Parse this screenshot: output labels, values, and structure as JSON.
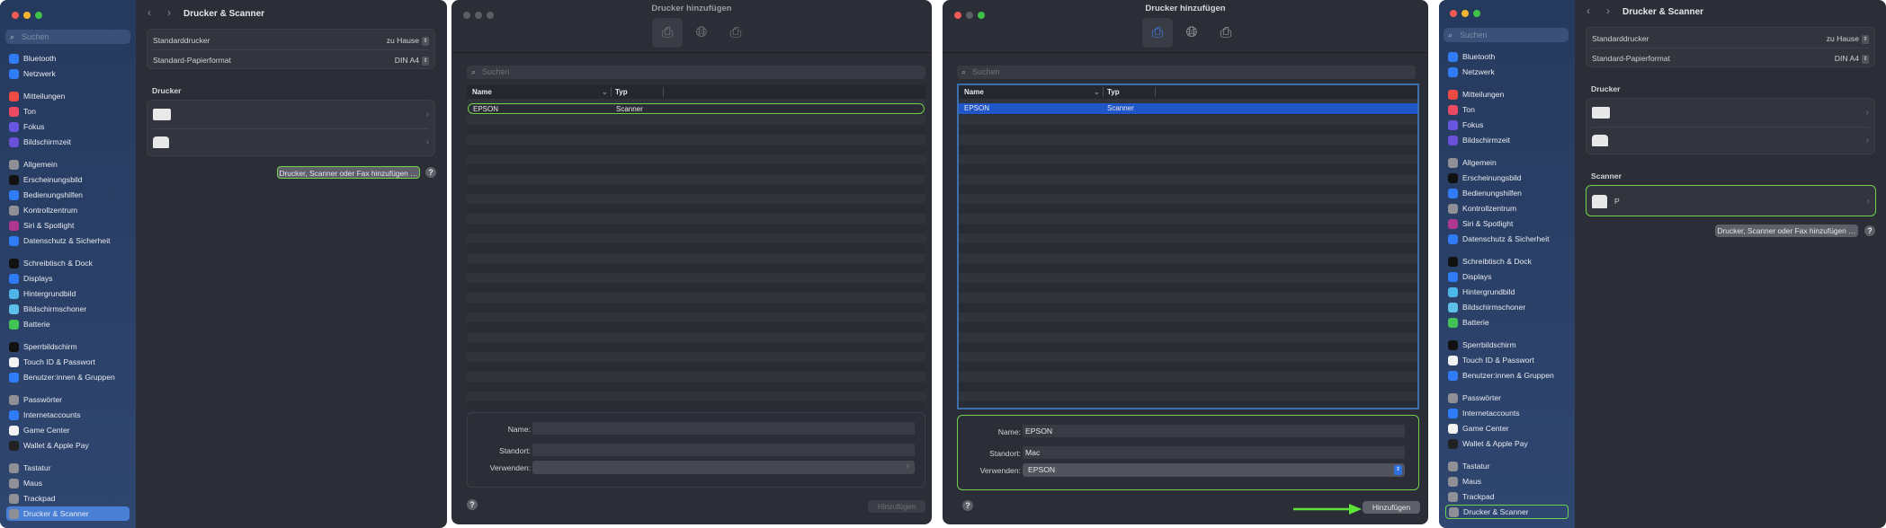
{
  "sidebar": {
    "search_placeholder": "Suchen",
    "items": [
      {
        "label": "Bluetooth",
        "icon": "bluetooth-icon",
        "color": "#2f7cf6",
        "group": 0
      },
      {
        "label": "Netzwerk",
        "icon": "network-icon",
        "color": "#2f7cf6",
        "group": 0
      },
      {
        "label": "Mitteilungen",
        "icon": "notifications-icon",
        "color": "#ef4b45",
        "group": 1
      },
      {
        "label": "Ton",
        "icon": "sound-icon",
        "color": "#ec4a63",
        "group": 1
      },
      {
        "label": "Fokus",
        "icon": "focus-icon",
        "color": "#6856e0",
        "group": 1
      },
      {
        "label": "Bildschirmzeit",
        "icon": "screen-time-icon",
        "color": "#6a4fd8",
        "group": 1
      },
      {
        "label": "Allgemein",
        "icon": "general-icon",
        "color": "#8e9096",
        "group": 2
      },
      {
        "label": "Erscheinungsbild",
        "icon": "appearance-icon",
        "color": "#111111",
        "group": 2
      },
      {
        "label": "Bedienungshilfen",
        "icon": "accessibility-icon",
        "color": "#2f7cf6",
        "group": 2
      },
      {
        "label": "Kontrollzentrum",
        "icon": "control-center-icon",
        "color": "#8e9096",
        "group": 2
      },
      {
        "label": "Siri & Spotlight",
        "icon": "siri-icon",
        "color": "#b0378f",
        "group": 2
      },
      {
        "label": "Datenschutz & Sicherheit",
        "icon": "privacy-hand-icon",
        "color": "#2f7cf6",
        "group": 2
      },
      {
        "label": "Schreibtisch & Dock",
        "icon": "desktop-dock-icon",
        "color": "#111111",
        "group": 3
      },
      {
        "label": "Displays",
        "icon": "displays-icon",
        "color": "#2f7cf6",
        "group": 3
      },
      {
        "label": "Hintergrundbild",
        "icon": "wallpaper-icon",
        "color": "#4cb6e8",
        "group": 3
      },
      {
        "label": "Bildschirmschoner",
        "icon": "screensaver-icon",
        "color": "#5ec0e8",
        "group": 3
      },
      {
        "label": "Batterie",
        "icon": "battery-icon",
        "color": "#3fc455",
        "group": 3
      },
      {
        "label": "Sperrbildschirm",
        "icon": "lock-screen-icon",
        "color": "#111111",
        "group": 4
      },
      {
        "label": "Touch ID & Passwort",
        "icon": "fingerprint-icon",
        "color": "#f2f2f2",
        "group": 4
      },
      {
        "label": "Benutzer:innen & Gruppen",
        "icon": "users-icon",
        "color": "#2f7cf6",
        "group": 4
      },
      {
        "label": "Passwörter",
        "icon": "key-icon",
        "color": "#8e9096",
        "group": 5
      },
      {
        "label": "Internetaccounts",
        "icon": "at-icon",
        "color": "#2f7cf6",
        "group": 5
      },
      {
        "label": "Game Center",
        "icon": "game-center-icon",
        "color": "#f2f2f2",
        "group": 5
      },
      {
        "label": "Wallet & Apple Pay",
        "icon": "wallet-icon",
        "color": "#222222",
        "group": 5
      },
      {
        "label": "Tastatur",
        "icon": "keyboard-icon",
        "color": "#8e9096",
        "group": 6
      },
      {
        "label": "Maus",
        "icon": "mouse-icon",
        "color": "#8e9096",
        "group": 6
      },
      {
        "label": "Trackpad",
        "icon": "trackpad-icon",
        "color": "#8e9096",
        "group": 6
      },
      {
        "label": "Drucker & Scanner",
        "icon": "printer-icon",
        "color": "#8e9096",
        "group": 6
      }
    ]
  },
  "settings": {
    "title": "Drucker & Scanner",
    "default_printer_label": "Standarddrucker",
    "default_printer_value": "zu Hause",
    "paper_label": "Standard-Papierformat",
    "paper_value": "DIN A4",
    "printers_heading": "Drucker",
    "scanner_heading": "Scanner",
    "scanner_name": "P",
    "add_button": "Drucker, Scanner oder Fax hinzufügen …",
    "help": "?"
  },
  "dialog": {
    "title": "Drucker hinzufügen",
    "search_placeholder": "Suchen",
    "col_name": "Name",
    "col_type": "Typ",
    "rows": [
      {
        "name": "EPSON",
        "type": "Scanner"
      }
    ],
    "name_label": "Name:",
    "location_label": "Standort:",
    "use_label": "Verwenden:",
    "filled": {
      "name": "EPSON",
      "location": "Mac",
      "use": "EPSON"
    },
    "add_button": "Hinzufügen",
    "help": "?"
  },
  "colors": {
    "highlight": "#6fd24a",
    "selection": "#2156c9",
    "accent": "#4a7fd6"
  }
}
